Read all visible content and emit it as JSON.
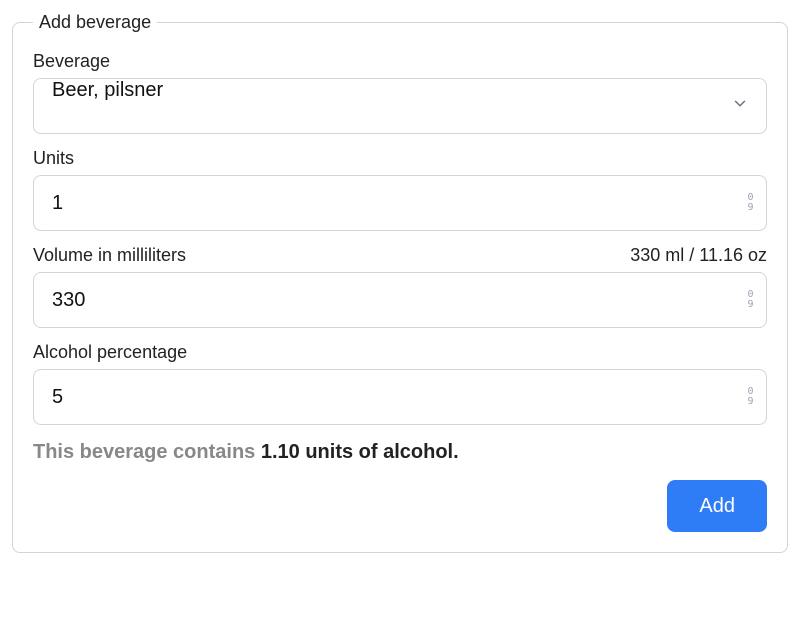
{
  "form": {
    "legend": "Add beverage",
    "beverage": {
      "label": "Beverage",
      "value": "Beer, pilsner"
    },
    "units": {
      "label": "Units",
      "value": "1"
    },
    "volume": {
      "label": "Volume in milliliters",
      "hint": "330 ml / 11.16 oz",
      "value": "330"
    },
    "alcohol": {
      "label": "Alcohol percentage",
      "value": "5"
    },
    "summary": {
      "prefix": "This beverage contains ",
      "strong": "1.10 units of alcohol."
    },
    "submit": "Add"
  },
  "stepper_glyph": {
    "top": "0",
    "bottom": "9"
  }
}
